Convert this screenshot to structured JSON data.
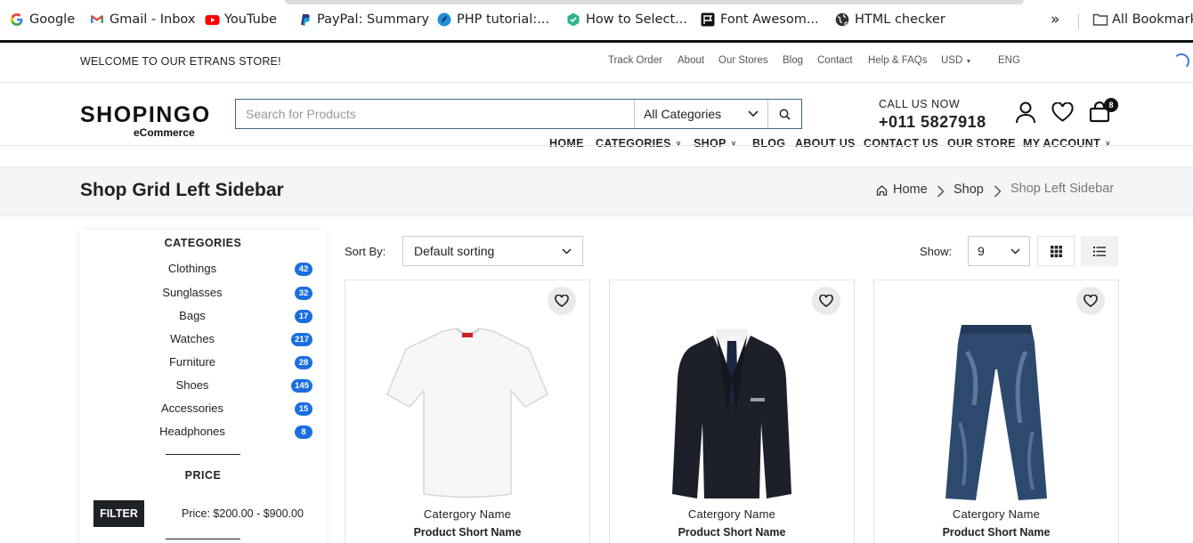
{
  "bookmarks": [
    {
      "label": "Google",
      "icon": "google-icon"
    },
    {
      "label": "Gmail - Inbox",
      "icon": "gmail-icon"
    },
    {
      "label": "YouTube",
      "icon": "youtube-icon"
    },
    {
      "label": "PayPal: Summary",
      "icon": "paypal-icon"
    },
    {
      "label": "PHP tutorial:...",
      "icon": "php-icon"
    },
    {
      "label": "How to Select...",
      "icon": "hexagon-icon"
    },
    {
      "label": "Font Awesom...",
      "icon": "fontawesome-icon"
    },
    {
      "label": "HTML checker",
      "icon": "globe-icon"
    },
    {
      "label": "»",
      "icon": "more-icon"
    },
    {
      "label": "All Bookmarks",
      "icon": "folder-icon"
    }
  ],
  "topbar": {
    "welcome": "WELCOME TO OUR ETRANS STORE!",
    "links": [
      "Track Order",
      "About",
      "Our Stores",
      "Blog",
      "Contact",
      "Help & FAQs"
    ],
    "currency": "USD",
    "language": "ENG"
  },
  "header": {
    "logo_main": "SHOPINGO",
    "logo_sub": "eCommerce",
    "search_placeholder": "Search for Products",
    "category_select": "All Categories",
    "call_label": "CALL US NOW",
    "phone": "+011 5827918",
    "cart_count": "8"
  },
  "nav": [
    {
      "label": "HOME",
      "caret": ""
    },
    {
      "label": "CATEGORIES",
      "caret": "˅"
    },
    {
      "label": "SHOP",
      "caret": "˅"
    },
    {
      "label": "BLOG",
      "caret": ""
    },
    {
      "label": "ABOUT US",
      "caret": ""
    },
    {
      "label": "CONTACT US",
      "caret": ""
    },
    {
      "label": "OUR STORE",
      "caret": ""
    },
    {
      "label": "MY ACCOUNT",
      "caret": "˅"
    }
  ],
  "breadcrumb": {
    "title": "Shop Grid Left Sidebar",
    "home": "Home",
    "shop": "Shop",
    "current": "Shop Left Sidebar"
  },
  "sidebar": {
    "categories_heading": "CATEGORIES",
    "categories": [
      {
        "name": "Clothings",
        "count": "42"
      },
      {
        "name": "Sunglasses",
        "count": "32"
      },
      {
        "name": "Bags",
        "count": "17"
      },
      {
        "name": "Watches",
        "count": "217"
      },
      {
        "name": "Furniture",
        "count": "28"
      },
      {
        "name": "Shoes",
        "count": "145"
      },
      {
        "name": "Accessories",
        "count": "15"
      },
      {
        "name": "Headphones",
        "count": "8"
      }
    ],
    "price_heading": "PRICE",
    "filter_label": "FILTER",
    "price_range": "Price: $200.00 - $900.00"
  },
  "toolbar": {
    "sort_label": "Sort By:",
    "sort_value": "Default sorting",
    "show_label": "Show:",
    "show_value": "9"
  },
  "products": [
    {
      "category": "Catergory Name",
      "name": "Product Short Name",
      "image": "white-tshirt"
    },
    {
      "category": "Catergory Name",
      "name": "Product Short Name",
      "image": "black-suit"
    },
    {
      "category": "Catergory Name",
      "name": "Product Short Name",
      "image": "blue-jeans"
    }
  ],
  "colors": {
    "badge": "#1a6fe0",
    "dark": "#1e2125",
    "crumb_bg": "#f4f5f6"
  }
}
